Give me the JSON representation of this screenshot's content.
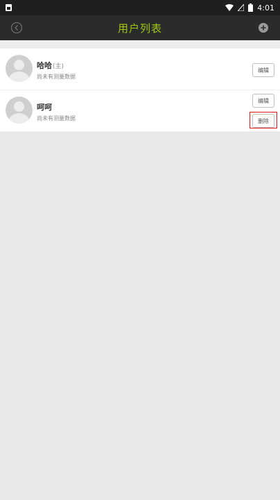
{
  "status_bar": {
    "time": "4:01",
    "icons": [
      "notification-icon",
      "wifi-icon",
      "signal-icon",
      "battery-icon"
    ]
  },
  "header": {
    "title": "用户列表",
    "back_icon": "back-circle-icon",
    "add_icon": "add-circle-icon",
    "title_color": "#a3c60f"
  },
  "users": [
    {
      "name": "哈哈",
      "tag": "(主)",
      "status": "尚未有测量数据",
      "edit_label": "编辑"
    },
    {
      "name": "呵呵",
      "tag": "",
      "status": "尚未有测量数据",
      "edit_label": "编辑",
      "delete_label": "删除"
    }
  ],
  "colors": {
    "accent": "#a3c60f",
    "highlight": "#e01616"
  }
}
